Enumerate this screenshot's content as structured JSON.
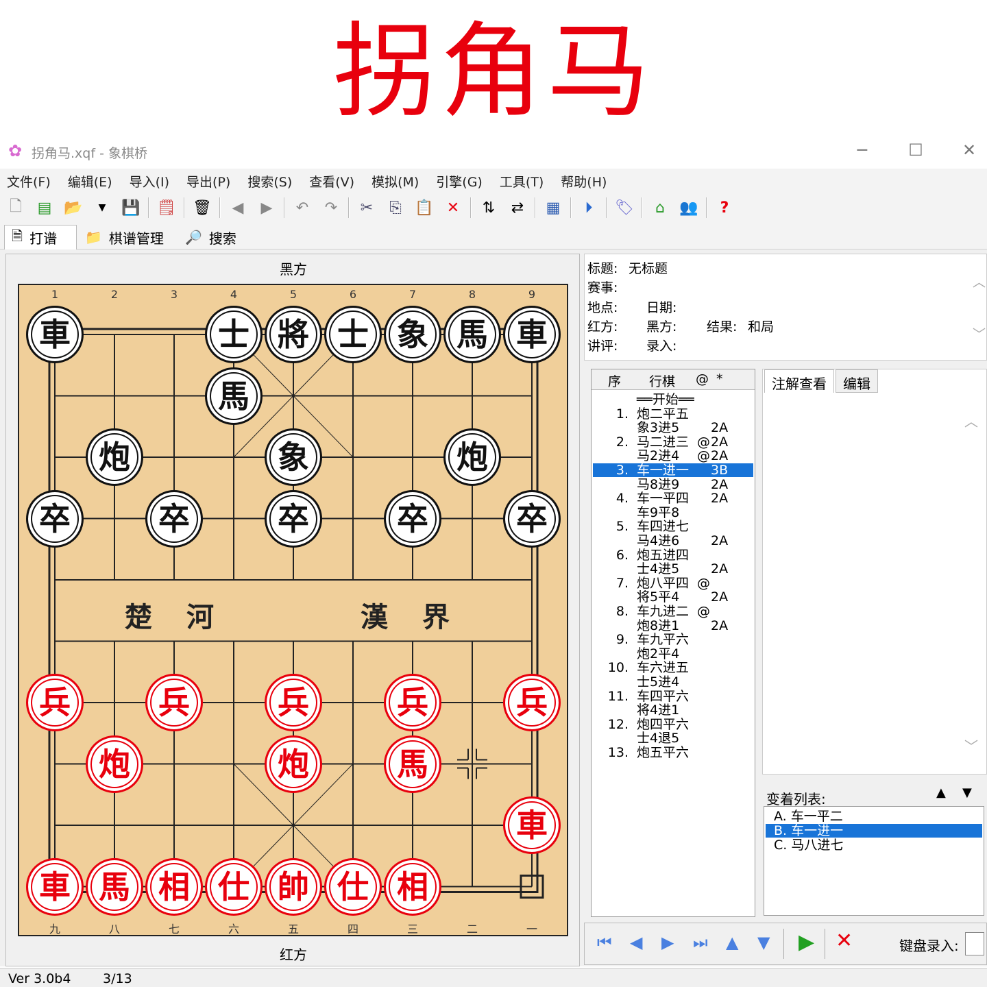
{
  "banner": {
    "text": "拐角马"
  },
  "window": {
    "title": "拐角马.xqf - 象棋桥",
    "icon": "flower-icon"
  },
  "menu": [
    "文件(F)",
    "编辑(E)",
    "导入(I)",
    "导出(P)",
    "搜索(S)",
    "查看(V)",
    "模拟(M)",
    "引擎(G)",
    "工具(T)",
    "帮助(H)"
  ],
  "tabs": {
    "daipu": "打谱",
    "manage": "棋谱管理",
    "search": "搜索"
  },
  "board": {
    "top_label": "黑方",
    "bottom_label": "红方",
    "top_files": [
      "1",
      "2",
      "3",
      "4",
      "5",
      "6",
      "7",
      "8",
      "9"
    ],
    "bottom_files": [
      "九",
      "八",
      "七",
      "六",
      "五",
      "四",
      "三",
      "二",
      "一"
    ],
    "river_left": "楚河",
    "river_right": "漢界",
    "pieces": [
      {
        "t": "車",
        "c": "black",
        "f": 0,
        "r": 0
      },
      {
        "t": "士",
        "c": "black",
        "f": 3,
        "r": 0
      },
      {
        "t": "將",
        "c": "black",
        "f": 4,
        "r": 0
      },
      {
        "t": "士",
        "c": "black",
        "f": 5,
        "r": 0
      },
      {
        "t": "象",
        "c": "black",
        "f": 6,
        "r": 0
      },
      {
        "t": "馬",
        "c": "black",
        "f": 7,
        "r": 0
      },
      {
        "t": "車",
        "c": "black",
        "f": 8,
        "r": 0
      },
      {
        "t": "馬",
        "c": "black",
        "f": 3,
        "r": 1
      },
      {
        "t": "炮",
        "c": "black",
        "f": 1,
        "r": 2
      },
      {
        "t": "象",
        "c": "black",
        "f": 4,
        "r": 2
      },
      {
        "t": "炮",
        "c": "black",
        "f": 7,
        "r": 2
      },
      {
        "t": "卒",
        "c": "black",
        "f": 0,
        "r": 3
      },
      {
        "t": "卒",
        "c": "black",
        "f": 2,
        "r": 3
      },
      {
        "t": "卒",
        "c": "black",
        "f": 4,
        "r": 3
      },
      {
        "t": "卒",
        "c": "black",
        "f": 6,
        "r": 3
      },
      {
        "t": "卒",
        "c": "black",
        "f": 8,
        "r": 3
      },
      {
        "t": "兵",
        "c": "red",
        "f": 0,
        "r": 6
      },
      {
        "t": "兵",
        "c": "red",
        "f": 2,
        "r": 6
      },
      {
        "t": "兵",
        "c": "red",
        "f": 4,
        "r": 6
      },
      {
        "t": "兵",
        "c": "red",
        "f": 6,
        "r": 6
      },
      {
        "t": "兵",
        "c": "red",
        "f": 8,
        "r": 6
      },
      {
        "t": "炮",
        "c": "red",
        "f": 1,
        "r": 7
      },
      {
        "t": "炮",
        "c": "red",
        "f": 4,
        "r": 7
      },
      {
        "t": "馬",
        "c": "red",
        "f": 6,
        "r": 7
      },
      {
        "t": "車",
        "c": "red",
        "f": 8,
        "r": 8
      },
      {
        "t": "車",
        "c": "red",
        "f": 0,
        "r": 9
      },
      {
        "t": "馬",
        "c": "red",
        "f": 1,
        "r": 9
      },
      {
        "t": "相",
        "c": "red",
        "f": 2,
        "r": 9
      },
      {
        "t": "仕",
        "c": "red",
        "f": 3,
        "r": 9
      },
      {
        "t": "帥",
        "c": "red",
        "f": 4,
        "r": 9
      },
      {
        "t": "仕",
        "c": "red",
        "f": 5,
        "r": 9
      },
      {
        "t": "相",
        "c": "red",
        "f": 6,
        "r": 9
      }
    ]
  },
  "info": {
    "title_label": "标题:",
    "title_value": "无标题",
    "event_label": "赛事:",
    "place_label": "地点:",
    "date_label": "日期:",
    "red_label": "红方:",
    "black_label": "黑方:",
    "result_label": "结果:",
    "result_value": "和局",
    "comment_label": "讲评:",
    "entry_label": "录入:"
  },
  "movelist": {
    "headers": [
      "序",
      "行棋",
      "@",
      "*"
    ],
    "rows": [
      {
        "n": "",
        "m": "══开始══",
        "k": "",
        "c": ""
      },
      {
        "n": "1.",
        "m": "炮二平五",
        "k": "",
        "c": ""
      },
      {
        "n": "",
        "m": "象3进5",
        "k": "",
        "c": "2A"
      },
      {
        "n": "2.",
        "m": "马二进三",
        "k": "@",
        "c": "2A"
      },
      {
        "n": "",
        "m": "马2进4",
        "k": "@",
        "c": "2A"
      },
      {
        "n": "3.",
        "m": "车一进一",
        "k": "",
        "c": "3B",
        "sel": true
      },
      {
        "n": "",
        "m": "马8进9",
        "k": "",
        "c": "2A"
      },
      {
        "n": "4.",
        "m": "车一平四",
        "k": "",
        "c": "2A"
      },
      {
        "n": "",
        "m": "车9平8",
        "k": "",
        "c": ""
      },
      {
        "n": "5.",
        "m": "车四进七",
        "k": "",
        "c": ""
      },
      {
        "n": "",
        "m": "马4进6",
        "k": "",
        "c": "2A"
      },
      {
        "n": "6.",
        "m": "炮五进四",
        "k": "",
        "c": ""
      },
      {
        "n": "",
        "m": "士4进5",
        "k": "",
        "c": "2A"
      },
      {
        "n": "7.",
        "m": "炮八平四",
        "k": "@",
        "c": ""
      },
      {
        "n": "",
        "m": "将5平4",
        "k": "",
        "c": "2A"
      },
      {
        "n": "8.",
        "m": "车九进二",
        "k": "@",
        "c": ""
      },
      {
        "n": "",
        "m": "炮8进1",
        "k": "",
        "c": "2A"
      },
      {
        "n": "9.",
        "m": "车九平六",
        "k": "",
        "c": ""
      },
      {
        "n": "",
        "m": "炮2平4",
        "k": "",
        "c": ""
      },
      {
        "n": "10.",
        "m": "车六进五",
        "k": "",
        "c": ""
      },
      {
        "n": "",
        "m": "士5进4",
        "k": "",
        "c": ""
      },
      {
        "n": "11.",
        "m": "车四平六",
        "k": "",
        "c": ""
      },
      {
        "n": "",
        "m": "将4进1",
        "k": "",
        "c": ""
      },
      {
        "n": "12.",
        "m": "炮四平六",
        "k": "",
        "c": ""
      },
      {
        "n": "",
        "m": "士4退5",
        "k": "",
        "c": ""
      },
      {
        "n": "13.",
        "m": "炮五平六",
        "k": "",
        "c": ""
      }
    ]
  },
  "notes": {
    "view_tab": "注解查看",
    "edit_tab": "编辑"
  },
  "variations": {
    "label": "变着列表:",
    "items": [
      {
        "text": "A. 车一平二"
      },
      {
        "text": "B. 车一进一",
        "sel": true
      },
      {
        "text": "C. 马八进七"
      }
    ]
  },
  "nav": {
    "keyboard_label": "键盘录入:"
  },
  "status": {
    "version": "Ver 3.0b4",
    "position": "3/13"
  }
}
